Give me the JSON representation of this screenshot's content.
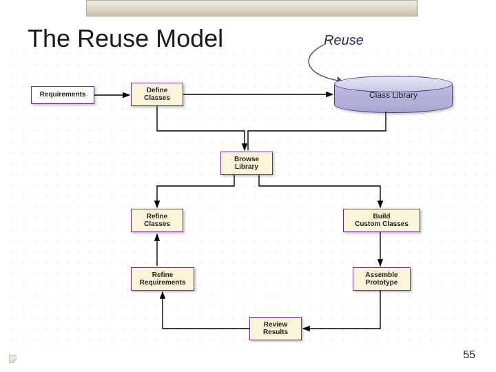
{
  "title": "The Reuse Model",
  "legend": "Reuse",
  "nodes": {
    "requirements": "Requirements",
    "define_classes": "Define\nClasses",
    "class_library": "Class Library",
    "browse_library": "Browse\nLibrary",
    "refine_classes": "Refine\nClasses",
    "build_custom_classes": "Build\nCustom Classes",
    "refine_requirements": "Refine\nRequirements",
    "assemble_prototype": "Assemble\nPrototype",
    "review_results": "Review\nResults"
  },
  "page_number": "55"
}
